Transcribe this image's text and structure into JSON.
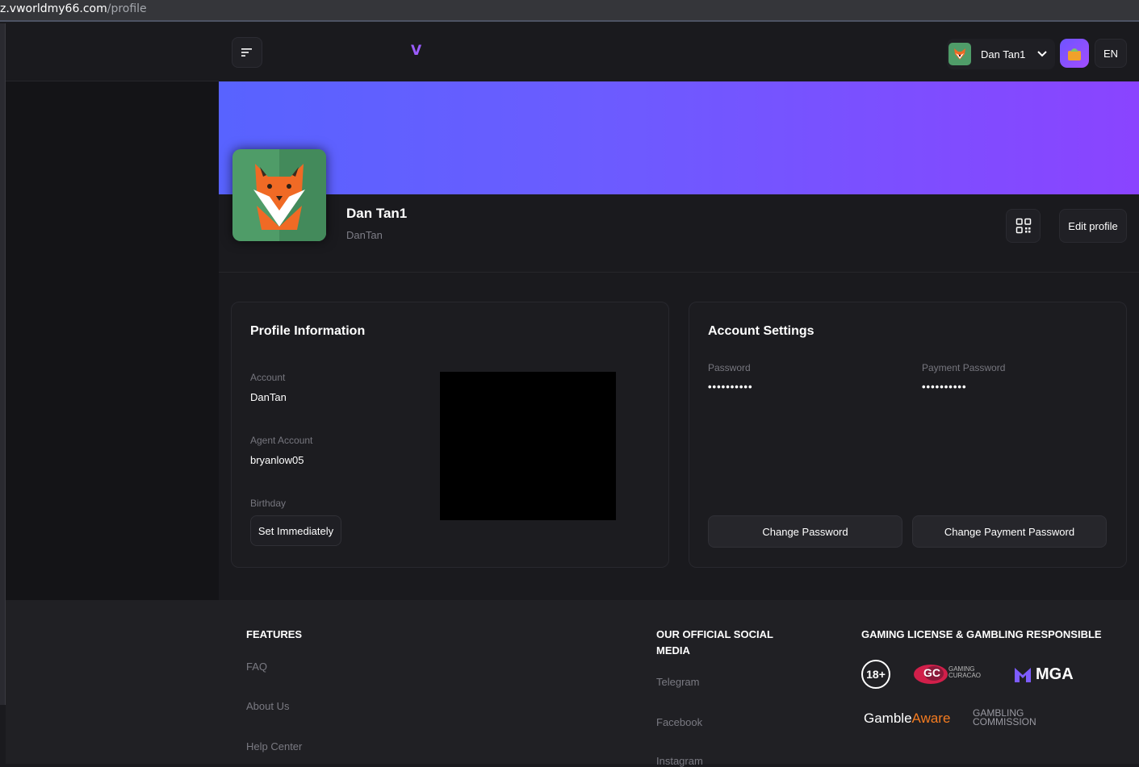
{
  "browser": {
    "url_host": "z.vworldmy66.com",
    "url_path": "/profile"
  },
  "header": {
    "logo_text": "V",
    "user_name": "Dan Tan1",
    "language": "EN",
    "brand_color": "#9b5cff"
  },
  "profile": {
    "display_name": "Dan Tan1",
    "username": "DanTan",
    "edit_label": "Edit profile",
    "banner_colors": [
      "#5863ff",
      "#8a44ff"
    ]
  },
  "profile_info": {
    "title": "Profile Information",
    "account_label": "Account",
    "account_value": "DanTan",
    "agent_label": "Agent Account",
    "agent_value": "bryanlow05",
    "birthday_label": "Birthday",
    "birthday_button": "Set Immediately"
  },
  "account_settings": {
    "title": "Account Settings",
    "password_label": "Password",
    "password_value": "••••••••••",
    "payment_password_label": "Payment Password",
    "payment_password_value": "••••••••••",
    "change_password_button": "Change Password",
    "change_payment_password_button": "Change Payment Password"
  },
  "footer": {
    "features_title": "FEATURES",
    "features_links": [
      "FAQ",
      "About Us",
      "Help Center"
    ],
    "social_title_line1": "OUR OFFICIAL SOCIAL",
    "social_title_line2": "MEDIA",
    "social_links": [
      "Telegram",
      "Facebook",
      "Instagram"
    ],
    "license_title": "GAMING LICENSE & GAMBLING RESPONSIBLE",
    "age_badge": "18+",
    "gc_text": "GC",
    "gc_sub_line1": "GAMING",
    "gc_sub_line2": "CURACAO",
    "mga_text": "MGA",
    "gamble_text": "Gamble",
    "aware_text": "Aware",
    "commission_line1": "GAMBLING",
    "commission_line2": "COMMISSION"
  }
}
